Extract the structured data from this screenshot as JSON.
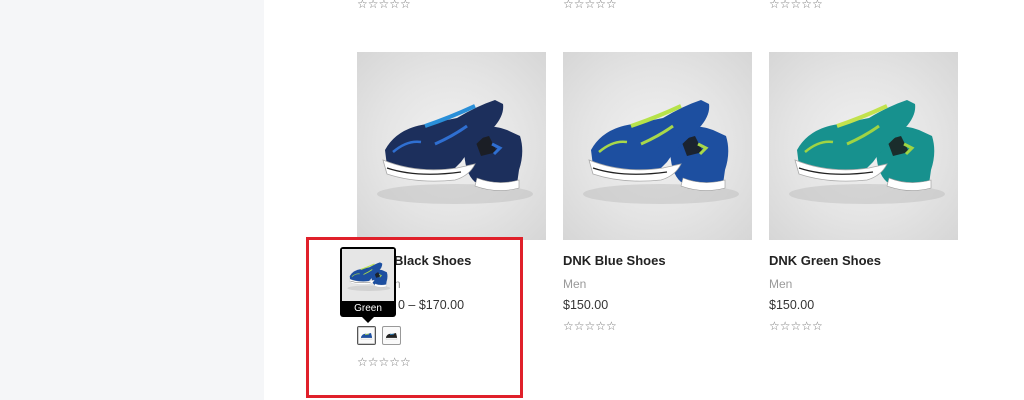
{
  "top_ratings": [
    {
      "stars": "☆☆☆☆☆"
    },
    {
      "stars": "☆☆☆☆☆"
    },
    {
      "stars": "☆☆☆☆☆"
    }
  ],
  "products": [
    {
      "title": "Black Shoes",
      "category": "n",
      "price": "0 – $170.00",
      "rating_stars": "☆☆☆☆☆",
      "swatches": [
        {
          "name": "Green",
          "selected": true
        },
        {
          "name": "Black",
          "selected": false
        }
      ],
      "colors": {
        "upper": "#1c2f5c",
        "accent": "#2f6fd1",
        "lace": "#2a8fd8",
        "sole": "#ffffff"
      }
    },
    {
      "title": "DNK Blue Shoes",
      "category": "Men",
      "price": "$150.00",
      "rating_stars": "☆☆☆☆☆",
      "colors": {
        "upper": "#1d4fa0",
        "accent": "#a8d84a",
        "lace": "#b6e24a",
        "sole": "#ffffff"
      }
    },
    {
      "title": "DNK Green Shoes",
      "category": "Men",
      "price": "$150.00",
      "rating_stars": "☆☆☆☆☆",
      "colors": {
        "upper": "#17918e",
        "accent": "#9fd443",
        "lace": "#c2e24d",
        "sole": "#ffffff"
      }
    }
  ],
  "tooltip": {
    "label": "Green"
  },
  "highlight_color": "#e0202a"
}
